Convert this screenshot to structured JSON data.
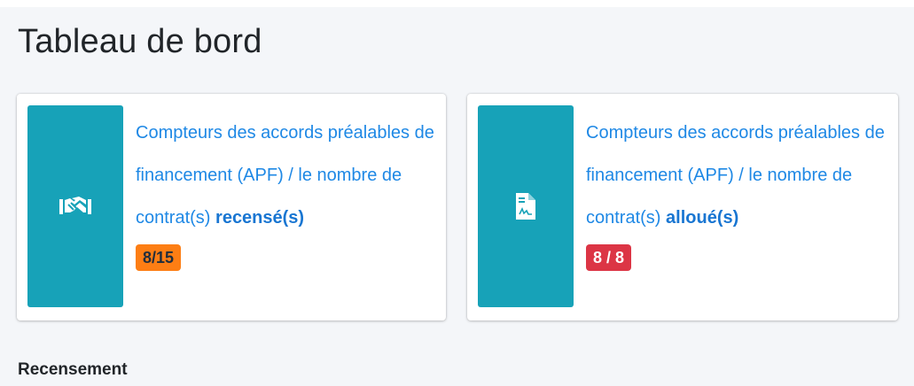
{
  "page": {
    "title": "Tableau de bord"
  },
  "cards": [
    {
      "icon": "handshake-icon",
      "text_main": "Compteurs des accords préalables de financement (APF) / le nombre de contrat(s) ",
      "text_emphasis": "recensé(s)",
      "badge": "8/15",
      "badge_color": "#fd7e14"
    },
    {
      "icon": "file-contract-icon",
      "text_main": "Compteurs des accords préalables de financement (APF) / le nombre de contrat(s) ",
      "text_emphasis": "alloué(s)",
      "badge": "8 / 8",
      "badge_color": "#dc3545"
    }
  ],
  "sections": {
    "recensement_label": "Recensement"
  },
  "colors": {
    "accent": "#17a2b8",
    "link": "#1e88e5",
    "background": "#f4f6f9"
  }
}
